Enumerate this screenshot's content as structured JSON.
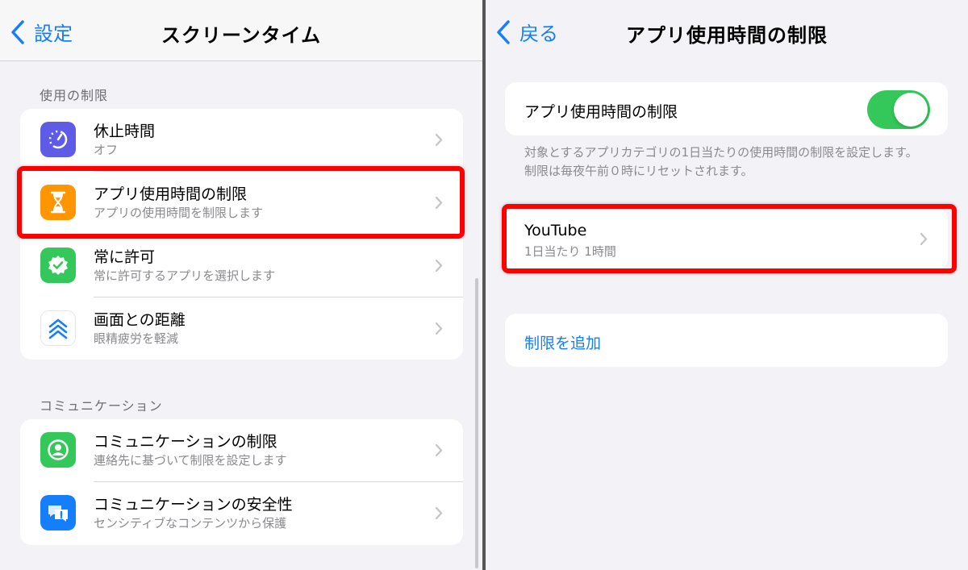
{
  "left": {
    "nav": {
      "back_label": "設定",
      "title": "スクリーンタイム"
    },
    "section1": {
      "header": "使用の制限",
      "items": [
        {
          "title": "休止時間",
          "subtitle": "オフ",
          "icon": "downtime-icon",
          "icon_color": "#5e5ce6"
        },
        {
          "title": "アプリ使用時間の制限",
          "subtitle": "アプリの使用時間を制限します",
          "icon": "hourglass-icon",
          "icon_color": "#ff9500"
        },
        {
          "title": "常に許可",
          "subtitle": "常に許可するアプリを選択します",
          "icon": "checkmark-badge-icon",
          "icon_color": "#34c759"
        },
        {
          "title": "画面との距離",
          "subtitle": "眼精疲労を軽減",
          "icon": "double-chevron-up-icon",
          "icon_color": "#147efb"
        }
      ]
    },
    "section2": {
      "header": "コミュニケーション",
      "items": [
        {
          "title": "コミュニケーションの制限",
          "subtitle": "連絡先に基づいて制限を設定します",
          "icon": "person-circle-icon",
          "icon_color": "#34c759"
        },
        {
          "title": "コミュニケーションの安全性",
          "subtitle": "センシティブなコンテンツから保護",
          "icon": "message-alert-icon",
          "icon_color": "#147efb"
        }
      ]
    }
  },
  "right": {
    "nav": {
      "back_label": "戻る",
      "title": "アプリ使用時間の制限"
    },
    "toggle": {
      "label": "アプリ使用時間の制限",
      "on": true,
      "color": "#34c759"
    },
    "description": "対象とするアプリカテゴリの1日当たりの使用時間の制限を設定します。制限は毎夜午前０時にリセットされます。",
    "limit": {
      "title": "YouTube",
      "subtitle": "1日当たり 1時間"
    },
    "add_label": "制限を追加"
  },
  "colors": {
    "accent": "#147efb",
    "highlight": "#ff0000",
    "background": "#f2f2f7"
  }
}
